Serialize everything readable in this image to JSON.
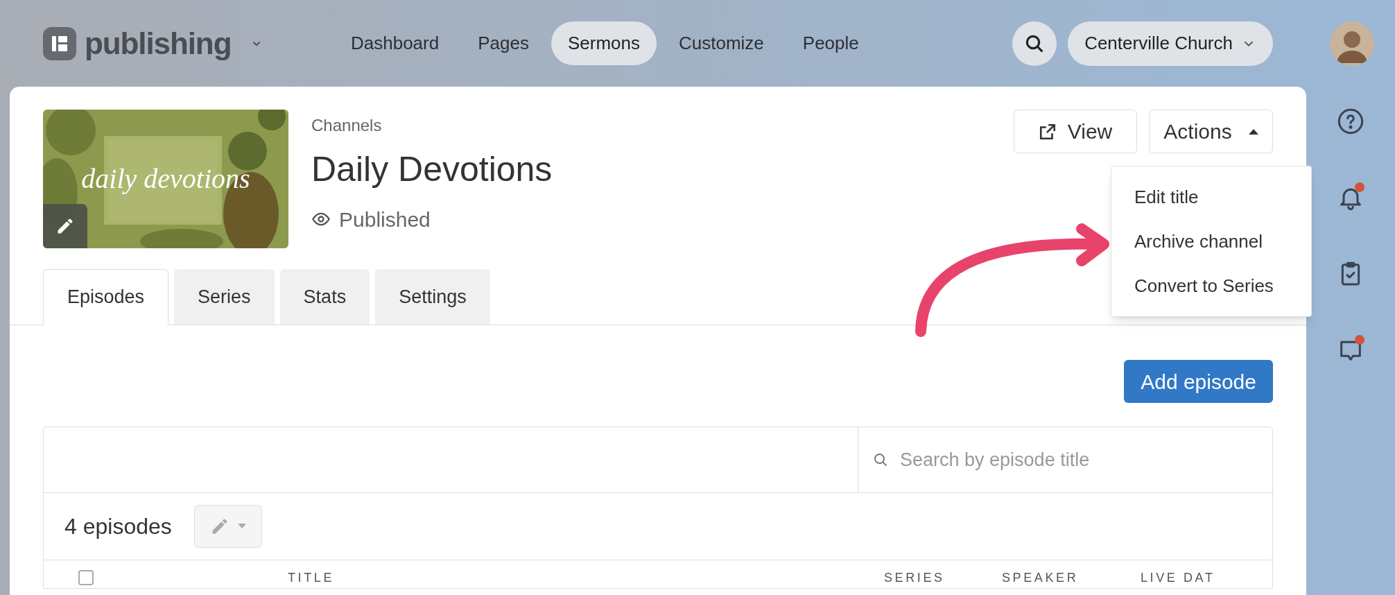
{
  "app": {
    "name": "publishing"
  },
  "nav": [
    {
      "label": "Dashboard",
      "selected": false
    },
    {
      "label": "Pages",
      "selected": false
    },
    {
      "label": "Sermons",
      "selected": true
    },
    {
      "label": "Customize",
      "selected": false
    },
    {
      "label": "People",
      "selected": false
    }
  ],
  "organization": "Centerville Church",
  "sidebar_icons": [
    {
      "kind": "help",
      "badge": false
    },
    {
      "kind": "bell",
      "badge": true
    },
    {
      "kind": "clipboard",
      "badge": false
    },
    {
      "kind": "chat",
      "badge": true
    }
  ],
  "header": {
    "breadcrumb": "Channels",
    "title": "Daily Devotions",
    "status": "Published",
    "thumbnail": {
      "caption": "daily devotions"
    }
  },
  "buttons": {
    "view": "View",
    "actions": "Actions"
  },
  "actions_menu": {
    "expanded": true,
    "items": [
      "Edit title",
      "Archive channel",
      "Convert to Series"
    ]
  },
  "tabs": [
    {
      "label": "Episodes",
      "selected": true
    },
    {
      "label": "Series",
      "selected": false
    },
    {
      "label": "Stats",
      "selected": false
    },
    {
      "label": "Settings",
      "selected": false
    }
  ],
  "add_button": "Add episode",
  "search": {
    "placeholder": "Search by episode title"
  },
  "count": "4 episodes",
  "table": {
    "select_all": {
      "checked": false
    },
    "columns": [
      "TITLE",
      "SERIES",
      "SPEAKER",
      "LIVE DAT"
    ]
  }
}
